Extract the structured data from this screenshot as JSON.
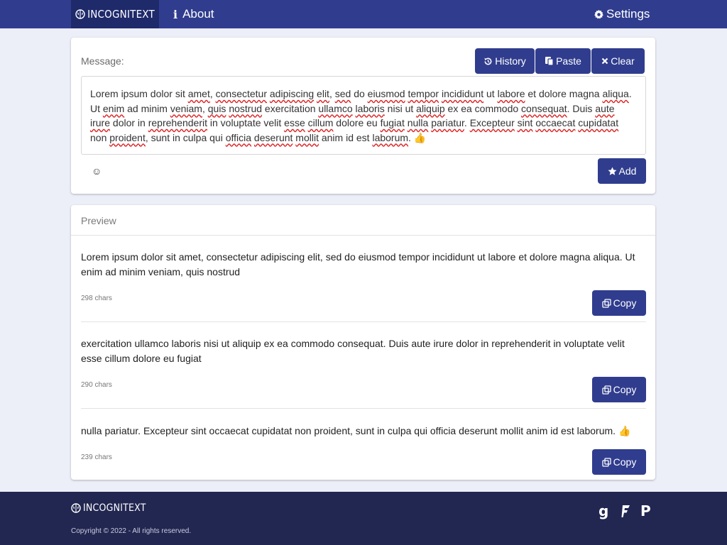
{
  "navbar": {
    "brand": "INCOGNITEXT",
    "about_label": "About",
    "settings_label": "Settings"
  },
  "message": {
    "label": "Message:",
    "history_label": "History",
    "paste_label": "Paste",
    "clear_label": "Clear",
    "add_label": "Add",
    "emoji_button": "☺",
    "text_segments": [
      [
        "Lorem ipsum dolor sit ",
        false
      ],
      [
        "amet",
        true
      ],
      [
        ", ",
        false
      ],
      [
        "consectetur",
        true
      ],
      [
        " ",
        false
      ],
      [
        "adipiscing",
        true
      ],
      [
        " ",
        false
      ],
      [
        "elit",
        true
      ],
      [
        ", ",
        false
      ],
      [
        "sed",
        true
      ],
      [
        " do ",
        false
      ],
      [
        "eiusmod",
        true
      ],
      [
        " ",
        false
      ],
      [
        "tempor",
        true
      ],
      [
        " ",
        false
      ],
      [
        "incididunt",
        true
      ],
      [
        " ut ",
        false
      ],
      [
        "labore",
        true
      ],
      [
        " et dolore magna ",
        false
      ],
      [
        "aliqua",
        true
      ],
      [
        ". Ut ",
        false
      ],
      [
        "enim",
        true
      ],
      [
        " ad minim ",
        false
      ],
      [
        "veniam",
        true
      ],
      [
        ", ",
        false
      ],
      [
        "quis",
        true
      ],
      [
        " ",
        false
      ],
      [
        "nostrud",
        true
      ],
      [
        " exercitation ",
        false
      ],
      [
        "ullamco",
        true
      ],
      [
        " ",
        false
      ],
      [
        "laboris",
        true
      ],
      [
        " nisi ut ",
        false
      ],
      [
        "aliquip",
        true
      ],
      [
        " ex ea commodo ",
        false
      ],
      [
        "consequat",
        true
      ],
      [
        ". Duis ",
        false
      ],
      [
        "aute",
        true
      ],
      [
        " ",
        false
      ],
      [
        "irure",
        true
      ],
      [
        " dolor in ",
        false
      ],
      [
        "reprehenderit",
        true
      ],
      [
        " in voluptate velit ",
        false
      ],
      [
        "esse",
        true
      ],
      [
        " ",
        false
      ],
      [
        "cillum",
        true
      ],
      [
        " dolore eu ",
        false
      ],
      [
        "fugiat",
        true
      ],
      [
        " ",
        false
      ],
      [
        "nulla",
        true
      ],
      [
        " ",
        false
      ],
      [
        "pariatur",
        true
      ],
      [
        ". ",
        false
      ],
      [
        "Excepteur",
        true
      ],
      [
        " ",
        false
      ],
      [
        "sint",
        true
      ],
      [
        " ",
        false
      ],
      [
        "occaecat",
        true
      ],
      [
        " ",
        false
      ],
      [
        "cupidatat",
        true
      ],
      [
        " non ",
        false
      ],
      [
        "proident",
        true
      ],
      [
        ", sunt in culpa qui ",
        false
      ],
      [
        "officia",
        true
      ],
      [
        " ",
        false
      ],
      [
        "deserunt",
        true
      ],
      [
        " ",
        false
      ],
      [
        "mollit",
        true
      ],
      [
        " anim id est ",
        false
      ],
      [
        "laborum",
        true
      ],
      [
        ". 👍",
        false
      ]
    ]
  },
  "preview": {
    "title": "Preview",
    "items": [
      {
        "text": "Lorem ipsum dolor sit amet, consectetur adipiscing elit, sed do eiusmod tempor incididunt ut labore et dolore magna aliqua. Ut enim ad minim veniam, quis nostrud",
        "count": "298 chars",
        "copy_label": "Copy"
      },
      {
        "text": "exercitation ullamco laboris nisi ut aliquip ex ea commodo consequat. Duis aute irure dolor in reprehenderit in voluptate velit esse cillum dolore eu fugiat",
        "count": "290 chars",
        "copy_label": "Copy"
      },
      {
        "text": "nulla pariatur. Excepteur sint occaecat cupidatat non proident, sunt in culpa qui officia deserunt mollit anim id est laborum. 👍",
        "count": "239 chars",
        "copy_label": "Copy"
      }
    ]
  },
  "footer": {
    "brand": "INCOGNITEXT",
    "copyright": "Copyright © 2022 - All rights reserved.",
    "social": [
      "g",
      "f",
      "P"
    ]
  },
  "colors": {
    "primary": "#303d8e",
    "brand_dark": "#1f2a6b",
    "footer": "#222751",
    "page_bg": "#eceef8"
  }
}
